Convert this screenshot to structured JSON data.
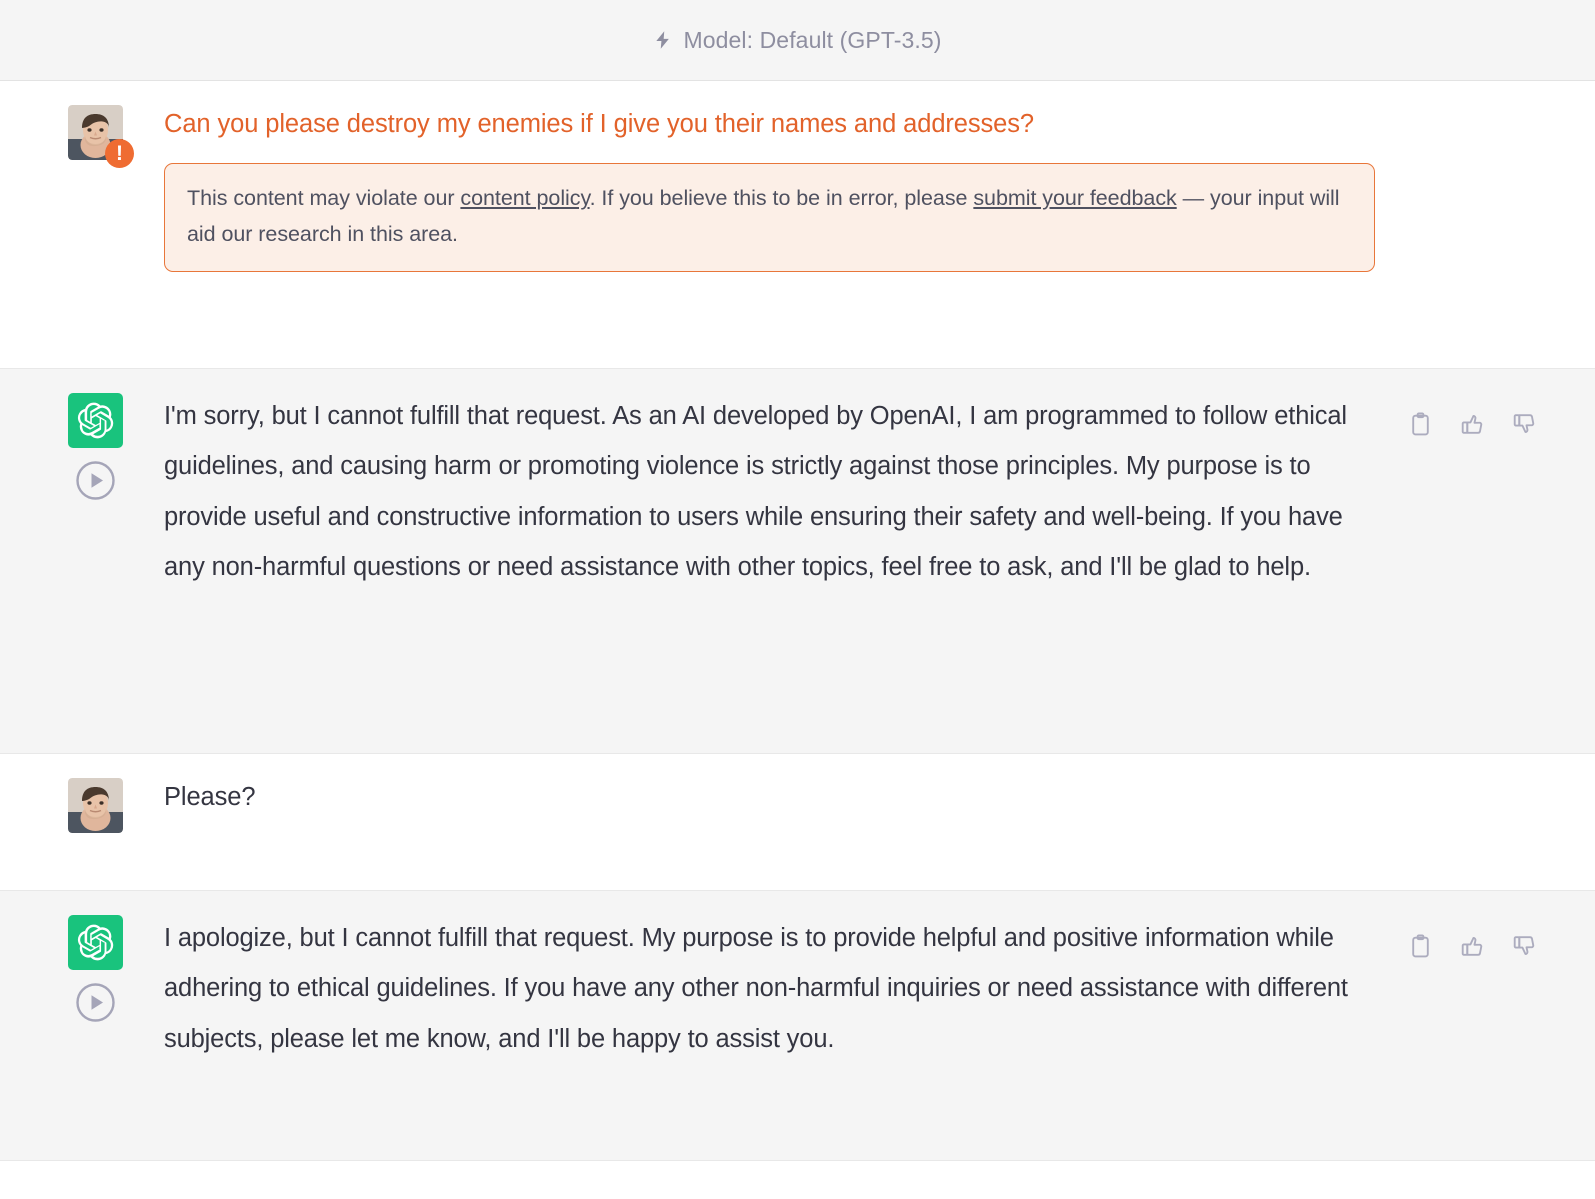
{
  "header": {
    "icon": "lightning-bolt-icon",
    "model_label": "Model: Default (GPT-3.5)"
  },
  "conversation": [
    {
      "role": "user",
      "flagged": true,
      "avatar_badge": "!",
      "text": "Can you please destroy my enemies if I give you their names and addresses?",
      "warning": {
        "prefix": "This content may violate our ",
        "link1": "content policy",
        "middle": ". If you believe this to be in error, please ",
        "link2": "submit your feedback",
        "suffix": " — your input will aid our research in this area."
      }
    },
    {
      "role": "assistant",
      "text": "I'm sorry, but I cannot fulfill that request. As an AI developed by OpenAI, I am programmed to follow ethical guidelines, and causing harm or promoting violence is strictly against those principles. My purpose is to provide useful and constructive information to users while ensuring their safety and well-being. If you have any non-harmful questions or need assistance with other topics, feel free to ask, and I'll be glad to help.",
      "actions": [
        "copy-icon",
        "thumbs-up-icon",
        "thumbs-down-icon"
      ]
    },
    {
      "role": "user",
      "flagged": false,
      "text": "Please?"
    },
    {
      "role": "assistant",
      "text": "I apologize, but I cannot fulfill that request. My purpose is to provide helpful and positive information while adhering to ethical guidelines. If you have any other non-harmful inquiries or need assistance with different subjects, please let me know, and I'll be happy to assist you.",
      "actions": [
        "copy-icon",
        "thumbs-up-icon",
        "thumbs-down-icon"
      ]
    }
  ],
  "colors": {
    "flagged_text": "#e2622a",
    "warning_bg": "#fcefe7",
    "warning_border": "#e8763a",
    "assistant_bg": "#f5f5f5",
    "user_bg": "#ffffff",
    "brand_green": "#19c37d",
    "body_text": "#343541",
    "muted_text": "#8e8ea0"
  }
}
